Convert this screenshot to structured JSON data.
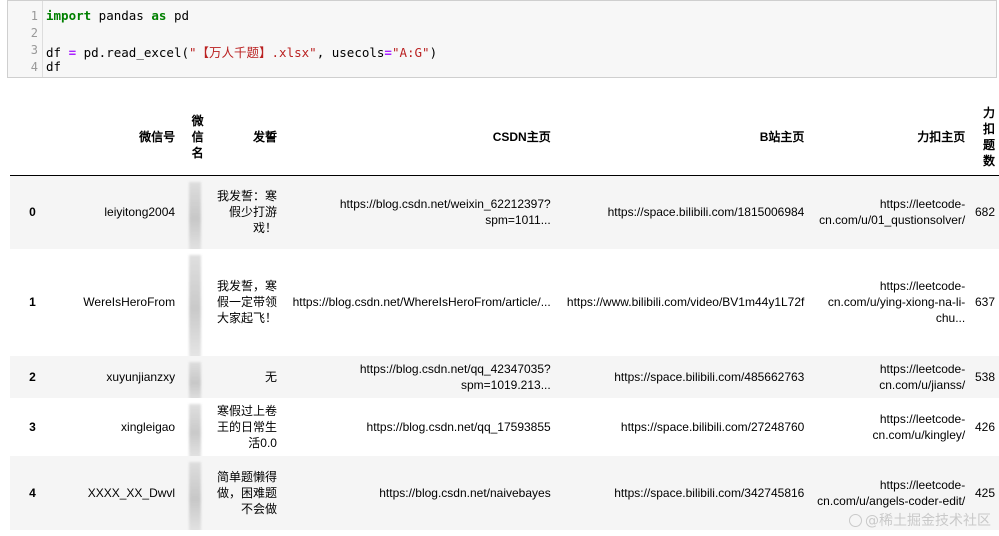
{
  "code": {
    "line_numbers": [
      "1",
      "2",
      "3",
      "4"
    ],
    "line1": {
      "kw1": "import",
      "mid": " pandas ",
      "kw2": "as",
      "end": " pd"
    },
    "line3": {
      "a": "df ",
      "eq": "=",
      "b": " pd.read_excel(",
      "s1": "\"【万人千题】.xlsx\"",
      "c": ", usecols",
      "eq2": "=",
      "s2": "\"A:G\"",
      "d": ")"
    },
    "line4": "df"
  },
  "table": {
    "headers": [
      "",
      "微信号",
      "微信名",
      "发誓",
      "CSDN主页",
      "B站主页",
      "力扣主页",
      "力扣题数"
    ],
    "rows": [
      {
        "index": "0",
        "wechat_id": "leiyitong2004",
        "oath": "我发誓：寒假少打游戏！",
        "csdn": "https://blog.csdn.net/weixin_62212397?spm=1011...",
        "bilibili": "https://space.bilibili.com/1815006984",
        "leetcode": "https://leetcode-cn.com/u/01_qustionsolver/",
        "count": "682"
      },
      {
        "index": "1",
        "wechat_id": "WereIsHeroFrom",
        "oath": "我发誓，寒假一定带领大家起飞！",
        "csdn": "https://blog.csdn.net/WhereIsHeroFrom/article/...",
        "bilibili": "https://www.bilibili.com/video/BV1m44y1L72f",
        "leetcode": "https://leetcode-cn.com/u/ying-xiong-na-li-chu...",
        "count": "637"
      },
      {
        "index": "2",
        "wechat_id": "xuyunjianzxy",
        "oath": "无",
        "csdn": "https://blog.csdn.net/qq_42347035?spm=1019.213...",
        "bilibili": "https://space.bilibili.com/485662763",
        "leetcode": "https://leetcode-cn.com/u/jianss/",
        "count": "538"
      },
      {
        "index": "3",
        "wechat_id": "xingleigao",
        "oath": "寒假过上卷王的日常生活0.0",
        "csdn": "https://blog.csdn.net/qq_17593855",
        "bilibili": "https://space.bilibili.com/27248760",
        "leetcode": "https://leetcode-cn.com/u/kingley/",
        "count": "426"
      },
      {
        "index": "4",
        "wechat_id": "XXXX_XX_Dwvl",
        "oath": "简单题懒得做，困难题不会做",
        "csdn": "https://blog.csdn.net/naivebayes",
        "bilibili": "https://space.bilibili.com/342745816",
        "leetcode": "https://leetcode-cn.com/u/angels-coder-edit/",
        "count": "425"
      }
    ]
  },
  "watermark": "@稀土掘金技术社区"
}
